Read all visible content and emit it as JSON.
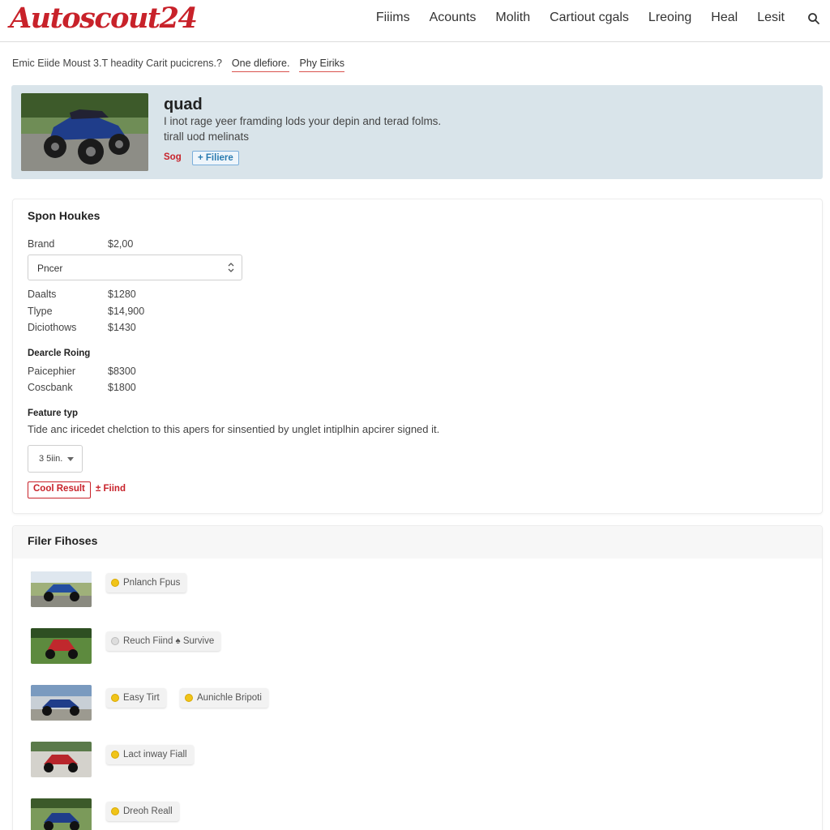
{
  "brand": {
    "logo_text": "Autoscout24",
    "color": "#c8222a"
  },
  "nav": [
    "Fiiims",
    "Acounts",
    "Molith",
    "Cartiout cgals",
    "Lreoing",
    "Heal",
    "Lesit"
  ],
  "search_icon": "search-icon",
  "breadcrumb": {
    "text": "Emic Eiide Moust 3.T headity Carit pucicrens.?",
    "links": [
      "One dlefiore.",
      "Phy Eiriks"
    ]
  },
  "hero": {
    "title": "quad",
    "desc1": "I inot rage yeer framding lods your depin and terad folms.",
    "desc2": "tirall uod melinats",
    "tag": "Sog",
    "filter_button": "+ Filiere"
  },
  "specs": {
    "title": "Spon Houkes",
    "brand_label": "Brand",
    "brand_value": "$2,00",
    "select_value": "Pncer",
    "rows": [
      {
        "label": "Daalts",
        "value": "$1280"
      },
      {
        "label": "Tlype",
        "value": "$14,900"
      },
      {
        "label": "Diciothows",
        "value": "$1430"
      }
    ],
    "section2_title": "Dearcle Roing",
    "rows2": [
      {
        "label": "Paicephier",
        "value": "$8300"
      },
      {
        "label": "Coscbank",
        "value": "$1800"
      }
    ],
    "feature_title": "Feature typ",
    "feature_desc": "Tide anc iricedet chelction to this apers for sinsentied by unglet intiplhin apcirer signed it.",
    "small_select": "3 5iin.",
    "cool_button": "Cool Result",
    "find_link": "± Fiind"
  },
  "filters": {
    "title": "Filer Fihoses",
    "items": [
      {
        "chips": [
          "Pnlanch Fpus"
        ]
      },
      {
        "chips": [
          "Reuch Fiind ♠ Survive"
        ]
      },
      {
        "chips": [
          "Easy Tirt",
          "Aunichle Bripoti"
        ]
      },
      {
        "chips": [
          "Lact inway Fiall"
        ]
      },
      {
        "chips": [
          "Dreoh Reall"
        ]
      }
    ]
  }
}
